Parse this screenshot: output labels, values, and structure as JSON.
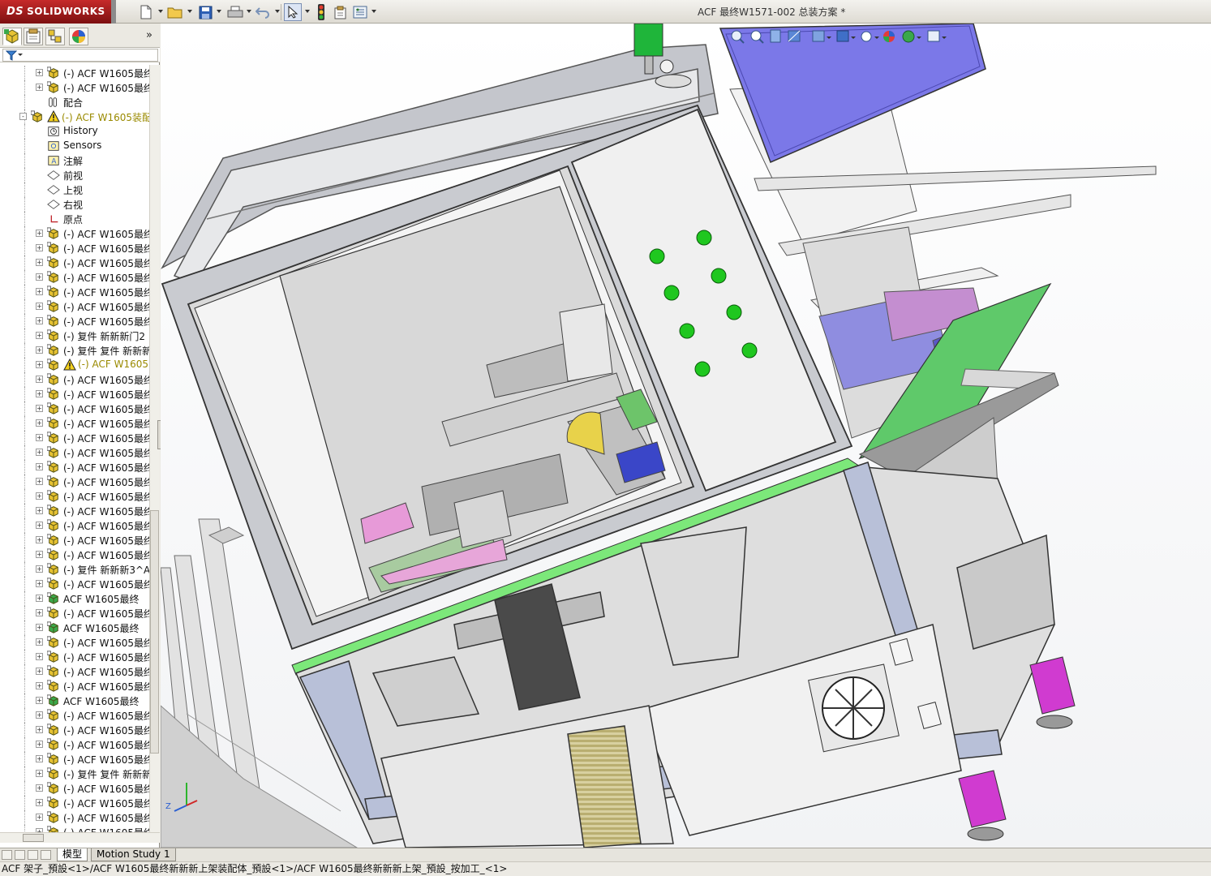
{
  "app": {
    "logo_text": "SOLIDWORKS",
    "document_title": "ACF 最终W1571-002 总装方案 *"
  },
  "toolbar": {
    "icons": [
      "new-document-icon",
      "open-folder-icon",
      "save-icon",
      "print-icon",
      "undo-icon",
      "select-arrow-icon",
      "rebuild-traffic-light-icon",
      "file-properties-icon",
      "options-icon"
    ]
  },
  "panel": {
    "tabs": [
      "feature-manager",
      "property-manager",
      "configuration-manager",
      "appearance-manager"
    ],
    "expand_glyph": "»"
  },
  "tree": {
    "rows": [
      {
        "depth": 2,
        "toggle": "+",
        "icon": "assembly",
        "text": "(-) ACF W1605最终",
        "warn": false
      },
      {
        "depth": 2,
        "toggle": "+",
        "icon": "assembly",
        "text": "(-) ACF W1605最终",
        "warn": false
      },
      {
        "depth": 2,
        "toggle": "",
        "icon": "mates",
        "text": "配合",
        "warn": false
      },
      {
        "depth": 1,
        "toggle": "-",
        "icon": "assembly-warn",
        "text": "(-) ACF W1605装配",
        "warn": true
      },
      {
        "depth": 2,
        "toggle": "",
        "icon": "history",
        "text": "History",
        "warn": false
      },
      {
        "depth": 2,
        "toggle": "",
        "icon": "sensors",
        "text": "Sensors",
        "warn": false
      },
      {
        "depth": 2,
        "toggle": "",
        "icon": "annotations",
        "text": "注解",
        "warn": false
      },
      {
        "depth": 2,
        "toggle": "",
        "icon": "plane",
        "text": "前视",
        "warn": false
      },
      {
        "depth": 2,
        "toggle": "",
        "icon": "plane",
        "text": "上视",
        "warn": false
      },
      {
        "depth": 2,
        "toggle": "",
        "icon": "plane",
        "text": "右视",
        "warn": false
      },
      {
        "depth": 2,
        "toggle": "",
        "icon": "origin",
        "text": "原点",
        "warn": false
      },
      {
        "depth": 2,
        "toggle": "+",
        "icon": "assembly",
        "text": "(-) ACF W1605最终",
        "warn": false
      },
      {
        "depth": 2,
        "toggle": "+",
        "icon": "assembly",
        "text": "(-) ACF W1605最终",
        "warn": false
      },
      {
        "depth": 2,
        "toggle": "+",
        "icon": "assembly",
        "text": "(-) ACF W1605最终",
        "warn": false
      },
      {
        "depth": 2,
        "toggle": "+",
        "icon": "assembly",
        "text": "(-) ACF W1605最终",
        "warn": false
      },
      {
        "depth": 2,
        "toggle": "+",
        "icon": "assembly",
        "text": "(-) ACF W1605最终",
        "warn": false
      },
      {
        "depth": 2,
        "toggle": "+",
        "icon": "assembly",
        "text": "(-) ACF W1605最终",
        "warn": false
      },
      {
        "depth": 2,
        "toggle": "+",
        "icon": "assembly",
        "text": "(-) ACF W1605最终",
        "warn": false
      },
      {
        "depth": 2,
        "toggle": "+",
        "icon": "assembly",
        "text": "(-) 复件 新新新门2",
        "warn": false
      },
      {
        "depth": 2,
        "toggle": "+",
        "icon": "assembly",
        "text": "(-) 复件 复件 新新新",
        "warn": false
      },
      {
        "depth": 2,
        "toggle": "+",
        "icon": "assembly-warn",
        "text": "(-) ACF W1605",
        "warn": true
      },
      {
        "depth": 2,
        "toggle": "+",
        "icon": "assembly",
        "text": "(-) ACF W1605最终",
        "warn": false
      },
      {
        "depth": 2,
        "toggle": "+",
        "icon": "assembly",
        "text": "(-) ACF W1605最终",
        "warn": false
      },
      {
        "depth": 2,
        "toggle": "+",
        "icon": "assembly",
        "text": "(-) ACF W1605最终",
        "warn": false
      },
      {
        "depth": 2,
        "toggle": "+",
        "icon": "assembly",
        "text": "(-) ACF W1605最终",
        "warn": false
      },
      {
        "depth": 2,
        "toggle": "+",
        "icon": "assembly",
        "text": "(-) ACF W1605最终",
        "warn": false
      },
      {
        "depth": 2,
        "toggle": "+",
        "icon": "assembly",
        "text": "(-) ACF W1605最终",
        "warn": false
      },
      {
        "depth": 2,
        "toggle": "+",
        "icon": "assembly",
        "text": "(-) ACF W1605最终",
        "warn": false
      },
      {
        "depth": 2,
        "toggle": "+",
        "icon": "assembly",
        "text": "(-) ACF W1605最终",
        "warn": false
      },
      {
        "depth": 2,
        "toggle": "+",
        "icon": "assembly",
        "text": "(-) ACF W1605最终",
        "warn": false
      },
      {
        "depth": 2,
        "toggle": "+",
        "icon": "assembly",
        "text": "(-) ACF W1605最终",
        "warn": false
      },
      {
        "depth": 2,
        "toggle": "+",
        "icon": "assembly",
        "text": "(-) ACF W1605最终",
        "warn": false
      },
      {
        "depth": 2,
        "toggle": "+",
        "icon": "assembly",
        "text": "(-) ACF W1605最终",
        "warn": false
      },
      {
        "depth": 2,
        "toggle": "+",
        "icon": "assembly",
        "text": "(-) ACF W1605最终",
        "warn": false
      },
      {
        "depth": 2,
        "toggle": "+",
        "icon": "assembly",
        "text": "(-) 复件 新新新3^A",
        "warn": false
      },
      {
        "depth": 2,
        "toggle": "+",
        "icon": "assembly",
        "text": "(-) ACF W1605最终",
        "warn": false
      },
      {
        "depth": 2,
        "toggle": "+",
        "icon": "assembly-green",
        "text": "ACF W1605最终",
        "warn": false
      },
      {
        "depth": 2,
        "toggle": "+",
        "icon": "assembly",
        "text": "(-) ACF W1605最终",
        "warn": false
      },
      {
        "depth": 2,
        "toggle": "+",
        "icon": "assembly-green",
        "text": "ACF W1605最终",
        "warn": false
      },
      {
        "depth": 2,
        "toggle": "+",
        "icon": "assembly",
        "text": "(-) ACF W1605最终",
        "warn": false
      },
      {
        "depth": 2,
        "toggle": "+",
        "icon": "assembly",
        "text": "(-) ACF W1605最终",
        "warn": false
      },
      {
        "depth": 2,
        "toggle": "+",
        "icon": "assembly",
        "text": "(-) ACF W1605最终",
        "warn": false
      },
      {
        "depth": 2,
        "toggle": "+",
        "icon": "assembly",
        "text": "(-) ACF W1605最终",
        "warn": false
      },
      {
        "depth": 2,
        "toggle": "+",
        "icon": "assembly-green",
        "text": "ACF W1605最终",
        "warn": false
      },
      {
        "depth": 2,
        "toggle": "+",
        "icon": "assembly",
        "text": "(-) ACF W1605最终",
        "warn": false
      },
      {
        "depth": 2,
        "toggle": "+",
        "icon": "assembly",
        "text": "(-) ACF W1605最终",
        "warn": false
      },
      {
        "depth": 2,
        "toggle": "+",
        "icon": "assembly",
        "text": "(-) ACF W1605最终",
        "warn": false
      },
      {
        "depth": 2,
        "toggle": "+",
        "icon": "assembly",
        "text": "(-) ACF W1605最终",
        "warn": false
      },
      {
        "depth": 2,
        "toggle": "+",
        "icon": "assembly",
        "text": "(-) 复件 复件 新新新",
        "warn": false
      },
      {
        "depth": 2,
        "toggle": "+",
        "icon": "assembly",
        "text": "(-) ACF W1605最终",
        "warn": false
      },
      {
        "depth": 2,
        "toggle": "+",
        "icon": "assembly",
        "text": "(-) ACF W1605最终",
        "warn": false
      },
      {
        "depth": 2,
        "toggle": "+",
        "icon": "assembly",
        "text": "(-) ACF W1605最终",
        "warn": false
      },
      {
        "depth": 2,
        "toggle": "+",
        "icon": "assembly",
        "text": "(-) ACF W1605最终",
        "warn": false
      }
    ]
  },
  "heads_up_toolbar": {
    "icons": [
      "zoom-to-fit-icon",
      "zoom-area-icon",
      "previous-view-icon",
      "section-view-icon",
      "view-orientation-icon",
      "display-style-icon",
      "hide-show-icon",
      "edit-appearance-icon",
      "apply-scene-icon",
      "view-settings-icon"
    ]
  },
  "triad": {
    "label_z": "Z"
  },
  "bottom_tabs": {
    "model": "模型",
    "motion": "Motion Study 1"
  },
  "status_bar": {
    "text": "ACF 架子_預設<1>/ACF W1605最终新新新上架装配体_預設<1>/ACF W1605最终新新新上架_預設_按加工_<1>"
  },
  "colors": {
    "frame": "#a9abb0",
    "glass": "#d9d9d9",
    "green_panel": "#5fc96a",
    "blue_panel": "#7b78e8",
    "magenta": "#d03bd0",
    "indicator_green": "#1fc71f"
  }
}
